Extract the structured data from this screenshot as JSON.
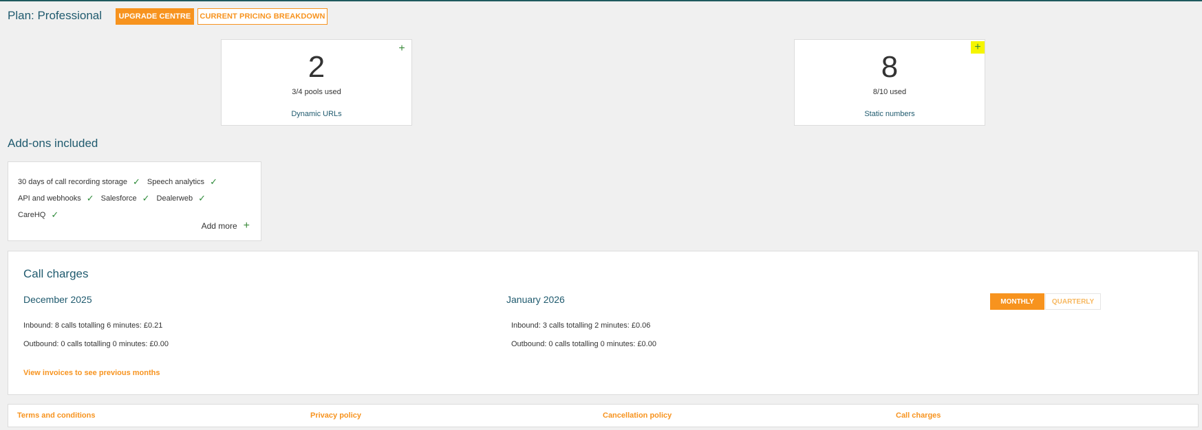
{
  "header": {
    "plan_title": "Plan: Professional",
    "upgrade_label": "UPGRADE CENTRE",
    "pricing_label": "CURRENT PRICING BREAKDOWN"
  },
  "stats": [
    {
      "number": "2",
      "sub": "3/4 pools used",
      "link": "Dynamic URLs",
      "icon": "plus-icon"
    },
    {
      "number": "8",
      "sub": "8/10 used",
      "link": "Static numbers",
      "icon": "plus-icon",
      "highlighted": true
    }
  ],
  "addons": {
    "heading": "Add-ons included",
    "items": [
      "30 days of call recording storage",
      "Speech analytics",
      "API and webhooks",
      "Salesforce",
      "Dealerweb",
      "CareHQ"
    ],
    "add_more": "Add more"
  },
  "charges": {
    "title": "Call charges",
    "periods": [
      {
        "month": "December 2025",
        "inbound": "Inbound: 8 calls totalling 6 minutes: £0.21",
        "outbound": "Outbound: 0 calls totalling 0 minutes: £0.00"
      },
      {
        "month": "January 2026",
        "inbound": "Inbound: 3 calls totalling 2 minutes: £0.06",
        "outbound": "Outbound: 0 calls totalling 0 minutes: £0.00"
      }
    ],
    "toggle_monthly": "MONTHLY",
    "toggle_quarterly": "QUARTERLY",
    "view_invoices": "View invoices to see previous months"
  },
  "footer": {
    "links": [
      "Terms and conditions",
      "Privacy policy",
      "Cancellation policy",
      "Call charges"
    ]
  },
  "colors": {
    "accent": "#f7931e",
    "heading": "#1f5a6e",
    "check": "#2e8b3a",
    "highlight": "#f5f500"
  }
}
